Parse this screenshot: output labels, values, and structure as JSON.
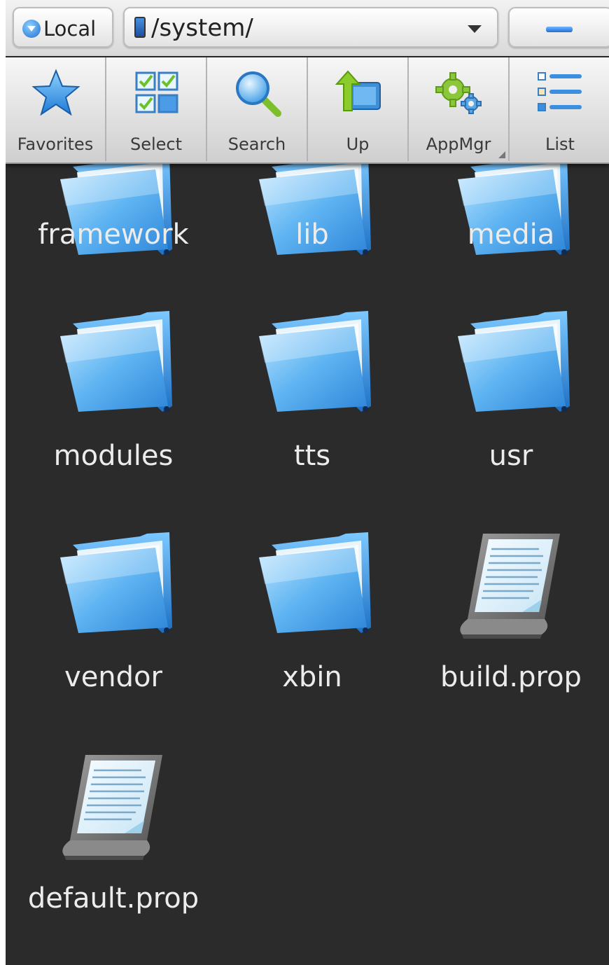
{
  "topbar": {
    "location_label": "Local",
    "path": "/system/"
  },
  "toolbar": {
    "items": [
      {
        "label": "Favorites",
        "icon": "star-icon"
      },
      {
        "label": "Select",
        "icon": "select-grid-icon"
      },
      {
        "label": "Search",
        "icon": "magnifier-icon"
      },
      {
        "label": "Up",
        "icon": "up-folder-icon"
      },
      {
        "label": "AppMgr",
        "icon": "gears-icon"
      },
      {
        "label": "List",
        "icon": "list-view-icon"
      }
    ]
  },
  "files": {
    "partial_row": [
      {
        "name": "framework",
        "type": "folder"
      },
      {
        "name": "lib",
        "type": "folder"
      },
      {
        "name": "media",
        "type": "folder"
      }
    ],
    "items": [
      {
        "name": "modules",
        "type": "folder"
      },
      {
        "name": "tts",
        "type": "folder"
      },
      {
        "name": "usr",
        "type": "folder"
      },
      {
        "name": "vendor",
        "type": "folder"
      },
      {
        "name": "xbin",
        "type": "folder"
      },
      {
        "name": "build.prop",
        "type": "file"
      },
      {
        "name": "default.prop",
        "type": "file"
      }
    ]
  },
  "colors": {
    "background": "#2b2b2b",
    "folder_blue": "#4aa3ec",
    "label_text": "#ececec"
  }
}
